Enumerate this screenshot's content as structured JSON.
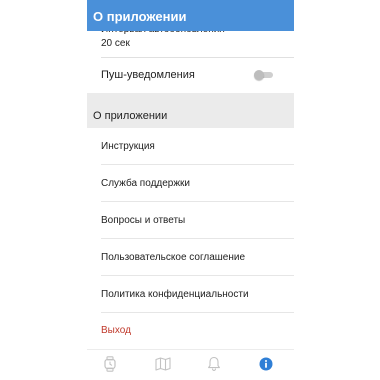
{
  "app_bar": {
    "title": "О приложении"
  },
  "settings": {
    "autoupdate_interval_label": "Интервал автообновления",
    "autoupdate_interval_value": "20 сек",
    "push_notifications_label": "Пуш-уведомления",
    "push_notifications_enabled": false
  },
  "about_section": {
    "header": "О приложении",
    "items": [
      {
        "label": "Инструкция"
      },
      {
        "label": "Служба поддержки"
      },
      {
        "label": "Вопросы и ответы"
      },
      {
        "label": "Пользовательское соглашение"
      },
      {
        "label": "Политика конфиденциальности"
      },
      {
        "label": "Выход"
      }
    ]
  },
  "bottom_nav": {
    "items": [
      {
        "icon": "watch-icon",
        "active": false
      },
      {
        "icon": "map-icon",
        "active": false
      },
      {
        "icon": "bell-icon",
        "active": false
      },
      {
        "icon": "info-icon",
        "active": true
      }
    ]
  },
  "colors": {
    "app_bar": "#4a90d9",
    "section_header_bg": "#ebebeb",
    "danger_text": "#c0392b",
    "nav_icon_inactive": "#c2c2c2",
    "nav_icon_active": "#2f7fd6"
  }
}
